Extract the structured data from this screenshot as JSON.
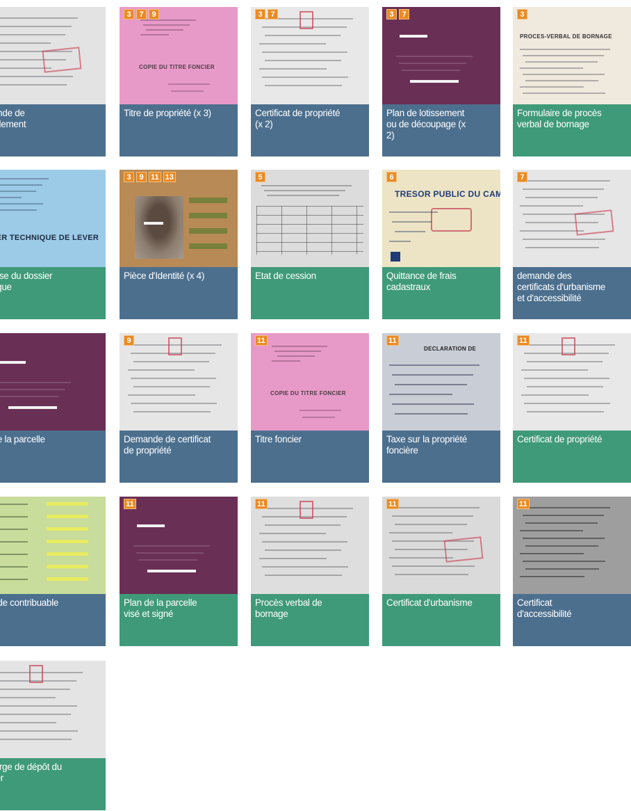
{
  "colors": {
    "blue": "#4c6f8e",
    "green": "#3f9a79",
    "badge": "#eb8a24"
  },
  "cards": [
    {
      "label": "mande de\nrcellement",
      "badges": [],
      "tone": "blue",
      "thumb": "paper-stamp",
      "bg": "#e3e3e3"
    },
    {
      "label": "Titre de propriété (x 3)",
      "badges": [
        "3",
        "7",
        "9"
      ],
      "tone": "blue",
      "thumb": "pink-title",
      "bg": "#e79ac8",
      "doc_text": "COPIE DU TITRE FONCIER"
    },
    {
      "label": "Certificat de propriété\n(x 2)",
      "badges": [
        "3",
        "7"
      ],
      "tone": "blue",
      "thumb": "paper-lines",
      "bg": "#e8e8e8"
    },
    {
      "label": "Plan de lotissement\nou de découpage (x\n2)",
      "badges": [
        "3",
        "7"
      ],
      "tone": "blue",
      "thumb": "purple-plan",
      "bg": "#6a2f55"
    },
    {
      "label": "Formulaire de procès\nverbal de bornage",
      "badges": [
        "3"
      ],
      "tone": "green",
      "thumb": "paper-form",
      "bg": "#efe9de",
      "doc_text": "PROCES-VERBAL DE BORNAGE"
    },
    {
      "label": "emise du dossier\nhnique",
      "badges": [],
      "tone": "green",
      "thumb": "blue-folder",
      "bg": "#9ccbe7",
      "doc_text": "SSIER TECHNIQUE DE LEVER"
    },
    {
      "label": "Pièce d'Identité (x 4)",
      "badges": [
        "3",
        "9",
        "11",
        "13"
      ],
      "tone": "blue",
      "thumb": "id-card",
      "bg": "#b88a55"
    },
    {
      "label": "Etat de cession",
      "badges": [
        "5"
      ],
      "tone": "green",
      "thumb": "paper-table",
      "bg": "#dcdcdc"
    },
    {
      "label": "Quittance de frais\ncadastraux",
      "badges": [
        "6"
      ],
      "tone": "green",
      "thumb": "receipt",
      "bg": "#ece4c5",
      "doc_text": "TRESOR PUBLIC DU CAME"
    },
    {
      "label": "demande des\ncertificats d'urbanisme\net d'accessibilité",
      "badges": [
        "7"
      ],
      "tone": "blue",
      "thumb": "paper-stamp",
      "bg": "#e6e6e6"
    },
    {
      "label": "n de la parcelle",
      "badges": [],
      "tone": "blue",
      "thumb": "purple-plan",
      "bg": "#6a2f55"
    },
    {
      "label": "Demande de certificat\nde propriété",
      "badges": [
        "9"
      ],
      "tone": "blue",
      "thumb": "paper-lines",
      "bg": "#e6e6e6"
    },
    {
      "label": "Titre foncier",
      "badges": [
        "11"
      ],
      "tone": "blue",
      "thumb": "pink-title",
      "bg": "#e79ac8",
      "doc_text": "COPIE DU TITRE FONCIER"
    },
    {
      "label": "Taxe sur la propriété\nfoncière",
      "badges": [
        "11"
      ],
      "tone": "blue",
      "thumb": "tax-doc",
      "bg": "#c9cdd6",
      "doc_text": "DECLARATION DE"
    },
    {
      "label": "Certificat de propriété",
      "badges": [
        "11"
      ],
      "tone": "green",
      "thumb": "paper-lines",
      "bg": "#e8e8e8"
    },
    {
      "label": "rte de contribuable",
      "badges": [],
      "tone": "blue",
      "thumb": "green-card",
      "bg": "#c8dc9c"
    },
    {
      "label": "Plan de la parcelle\nvisé et signé",
      "badges": [
        "11"
      ],
      "tone": "green",
      "thumb": "purple-plan",
      "bg": "#6a2f55"
    },
    {
      "label": "Procès verbal de\nbornage",
      "badges": [
        "11"
      ],
      "tone": "green",
      "thumb": "paper-lines",
      "bg": "#dedede"
    },
    {
      "label": "Certificat d'urbanisme",
      "badges": [
        "11"
      ],
      "tone": "green",
      "thumb": "paper-stamp",
      "bg": "#dadada"
    },
    {
      "label": "Certificat\nd'accessibilité",
      "badges": [
        "11"
      ],
      "tone": "blue",
      "thumb": "dark-paper",
      "bg": "#9e9e9e"
    },
    {
      "label": "charge de dépôt du\nssier",
      "badges": [],
      "tone": "green",
      "thumb": "paper-lines",
      "bg": "#e4e4e4"
    }
  ]
}
